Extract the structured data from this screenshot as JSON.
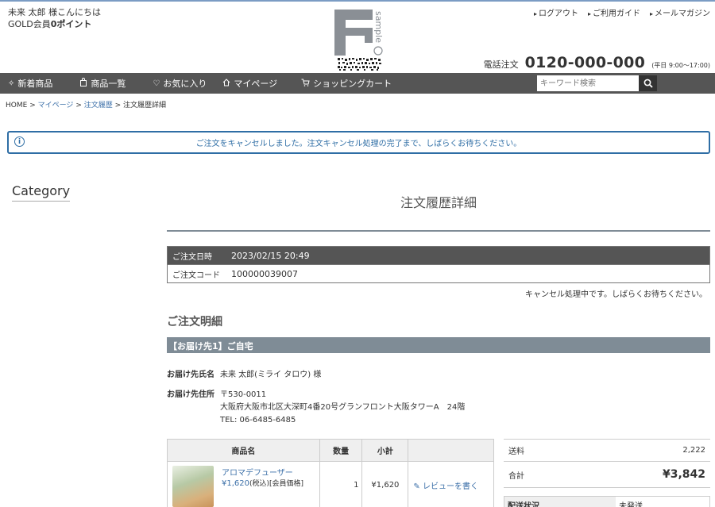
{
  "header": {
    "greeting_line1": "未来 太郎 様こんにちは",
    "greeting_rank": "GOLD会員",
    "greeting_points": "0ポイント",
    "top_links": [
      "ログアウト",
      "ご利用ガイド",
      "メールマガジン"
    ],
    "phone_label": "電話注文",
    "phone_number": "0120-000-000",
    "phone_hours": "(平日 9:00〜17:00)",
    "logo_letter": "F",
    "logo_text": "sample"
  },
  "nav": {
    "items": [
      {
        "label": "新着商品",
        "icon": "sparkle-icon"
      },
      {
        "label": "商品一覧",
        "icon": "bag-icon"
      },
      {
        "label": "お気に入り",
        "icon": "heart-icon"
      },
      {
        "label": "マイページ",
        "icon": "home-icon"
      },
      {
        "label": "ショッピングカート",
        "icon": "cart-icon"
      }
    ],
    "search_placeholder": "キーワード検索"
  },
  "breadcrumb": {
    "items": [
      "HOME",
      "マイページ",
      "注文履歴"
    ],
    "current": "注文履歴詳細",
    "separator": ">"
  },
  "alert": {
    "message": "ご注文をキャンセルしました。注文キャンセル処理の完了まで、しばらくお待ちください。"
  },
  "sidebar": {
    "title": "Category"
  },
  "main": {
    "title": "注文履歴詳細",
    "order_date_label": "ご注文日時",
    "order_date": "2023/02/15 20:49",
    "order_code_label": "ご注文コード",
    "order_code": "100000039007",
    "cancel_note": "キャンセル処理中です。しばらくお待ちください。",
    "detail_heading": "ご注文明細",
    "destination_heading": "【お届け先1】ご自宅",
    "recipient_label": "お届け先氏名",
    "recipient": "未来 太郎(ミライ タロウ) 様",
    "address_label": "お届け先住所",
    "postal": "〒530-0011",
    "address": "大阪府大阪市北区大深町4番20号グランフロント大阪タワーA　24階",
    "tel": "TEL: 06-6485-6485"
  },
  "products": {
    "headers": [
      "商品名",
      "数量",
      "小計",
      ""
    ],
    "rows": [
      {
        "name": "アロマデフューザー",
        "price": "¥1,620",
        "price_note": "(税込)[会員価格]",
        "qty": "1",
        "subtotal": "¥1,620",
        "review": "レビューを書く"
      }
    ]
  },
  "summary": {
    "shipping_label": "送料",
    "shipping": "2,222",
    "total_label": "合計",
    "total": "¥3,842",
    "status_label": "配送状況",
    "status": "未発送"
  },
  "colors": {
    "accent": "#2f6ea5",
    "nav_bg": "#555555",
    "section_bar": "#7f8c96"
  }
}
